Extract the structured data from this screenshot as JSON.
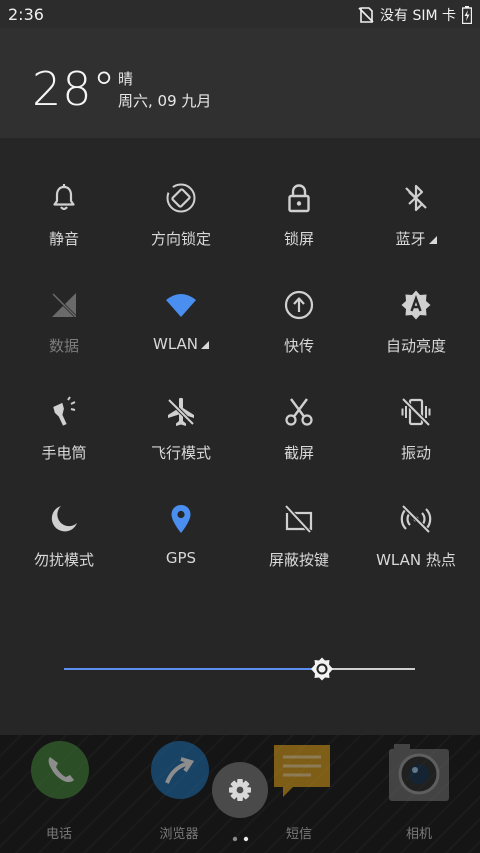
{
  "status_bar": {
    "time": "2:36",
    "sim": "没有 SIM 卡"
  },
  "header": {
    "temperature": "28°",
    "weather": "晴",
    "date": "周六, 09 九月"
  },
  "tiles": [
    {
      "label": "静音",
      "icon": "bell-icon"
    },
    {
      "label": "方向锁定",
      "icon": "rotate-lock-icon"
    },
    {
      "label": "锁屏",
      "icon": "lock-icon"
    },
    {
      "label": "蓝牙",
      "icon": "bluetooth-off-icon"
    },
    {
      "label": "数据",
      "icon": "mobile-data-off-icon"
    },
    {
      "label": "WLAN",
      "icon": "wifi-icon"
    },
    {
      "label": "快传",
      "icon": "quick-share-icon"
    },
    {
      "label": "自动亮度",
      "icon": "auto-brightness-icon"
    },
    {
      "label": "手电筒",
      "icon": "flashlight-icon"
    },
    {
      "label": "飞行模式",
      "icon": "airplane-off-icon"
    },
    {
      "label": "截屏",
      "icon": "scissors-icon"
    },
    {
      "label": "振动",
      "icon": "vibrate-off-icon"
    },
    {
      "label": "勿扰模式",
      "icon": "moon-icon"
    },
    {
      "label": "GPS",
      "icon": "location-icon"
    },
    {
      "label": "屏蔽按键",
      "icon": "block-keys-icon"
    },
    {
      "label": "WLAN 热点",
      "icon": "hotspot-off-icon"
    }
  ],
  "brightness": {
    "level": 0.73,
    "active_color": "#5c8ff0"
  },
  "dock": [
    {
      "label": "电话",
      "icon": "phone-icon"
    },
    {
      "label": "浏览器",
      "icon": "browser-icon"
    },
    {
      "label": "短信",
      "icon": "messages-icon"
    },
    {
      "label": "相机",
      "icon": "camera-icon"
    }
  ],
  "accent_color": "#4a8ff0"
}
